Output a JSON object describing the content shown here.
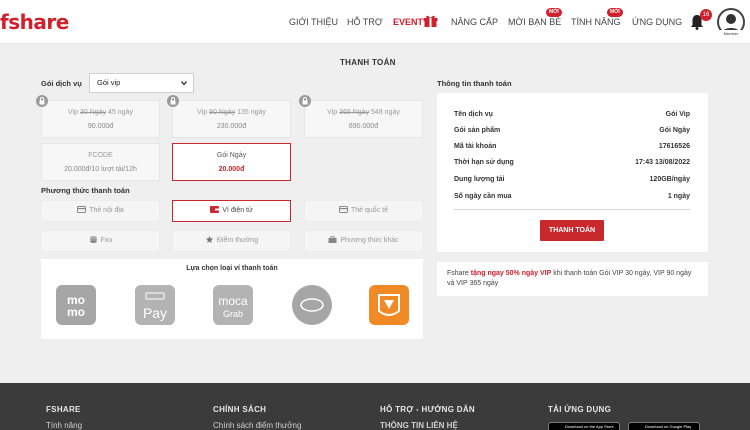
{
  "header": {
    "logo": "fshare",
    "nav": [
      {
        "label": "GIỚI THIỆU"
      },
      {
        "label": "HỖ TRỢ"
      },
      {
        "label": "EVENT"
      },
      {
        "label": "NÂNG CẤP"
      },
      {
        "label": "MỜI BẠN BÈ",
        "badge": "MỚI"
      },
      {
        "label": "TÍNH NĂNG",
        "badge": "MỚI"
      },
      {
        "label": "ỨNG DỤNG"
      }
    ],
    "notifications": "16",
    "avatar_label": "Member",
    "brand_color": "#d0202b"
  },
  "page_title": "THANH TOÁN",
  "service": {
    "label": "Gói dịch vụ",
    "selected": "Gói vip"
  },
  "plans": [
    {
      "title": "Vip",
      "old": "30 Ngày",
      "new": "45 ngày",
      "price": "90.000đ",
      "locked": true
    },
    {
      "title": "Vip",
      "old": "90 Ngày",
      "new": "135 ngày",
      "price": "230.000đ",
      "locked": true
    },
    {
      "title": "Vip",
      "old": "365 Ngày",
      "new": "548 ngày",
      "price": "690.000đ",
      "locked": true
    },
    {
      "title": "FCODE",
      "price": "20.000đ/10 lượt tải/12h"
    },
    {
      "title": "Gói Ngày",
      "price": "20.000đ",
      "selected": true
    }
  ],
  "payment_methods": {
    "label": "Phương thức thanh toán",
    "items": [
      {
        "label": "Thẻ nội địa",
        "icon": "card-icon"
      },
      {
        "label": "Ví điện tử",
        "icon": "wallet-icon",
        "selected": true
      },
      {
        "label": "Thẻ quốc tế",
        "icon": "card-icon"
      },
      {
        "label": "Fxu",
        "icon": "coins-icon"
      },
      {
        "label": "Điểm thưởng",
        "icon": "star-icon"
      },
      {
        "label": "Phương thức khác",
        "icon": "bag-icon"
      }
    ]
  },
  "wallets": {
    "title": "Lựa chọn loại ví thanh toán",
    "items": [
      {
        "name": "momo",
        "icon": "momo-logo"
      },
      {
        "name": "ShopeePay",
        "icon": "shopeepay-logo"
      },
      {
        "name": "moca Grab",
        "icon": "moca-logo"
      },
      {
        "name": "viettel money",
        "icon": "viettel-money-logo"
      },
      {
        "name": "fshare wallet",
        "icon": "fshare-wallet-logo"
      }
    ]
  },
  "info": {
    "title": "Thông tin thanh toán",
    "rows": [
      {
        "label": "Tên dịch vụ",
        "value": "Gói Vip"
      },
      {
        "label": "Gói sản phẩm",
        "value": "Gói Ngày"
      },
      {
        "label": "Mã tài khoản",
        "value": "17616526"
      },
      {
        "label": "Thời hạn sử dụng",
        "value": "17:43 13/08/2022"
      },
      {
        "label": "Dung lượng tải",
        "value": "120GB/ngày"
      },
      {
        "label": "Số ngày cần mua",
        "value": "1 ngày"
      }
    ],
    "pay_button": "THANH TOÁN"
  },
  "promo": {
    "prefix": "Fshare ",
    "highlight": "tặng ngay 50% ngày VIP",
    "suffix": " khi thanh toán Gói VIP 30 ngày, VIP 90 ngày và VIP 365 ngày"
  },
  "footer": {
    "columns": [
      {
        "heading": "FSHARE",
        "link": "Tính năng"
      },
      {
        "heading": "CHÍNH SÁCH",
        "link": "Chính sách điểm thưởng"
      },
      {
        "heading": "HỖ TRỢ - HƯỚNG DẪN",
        "link": "THÔNG TIN LIÊN HỆ"
      },
      {
        "heading": "TẢI ỨNG DỤNG",
        "link": ""
      }
    ],
    "stores": [
      "Download on the App Store",
      "Download on Google Play"
    ]
  }
}
